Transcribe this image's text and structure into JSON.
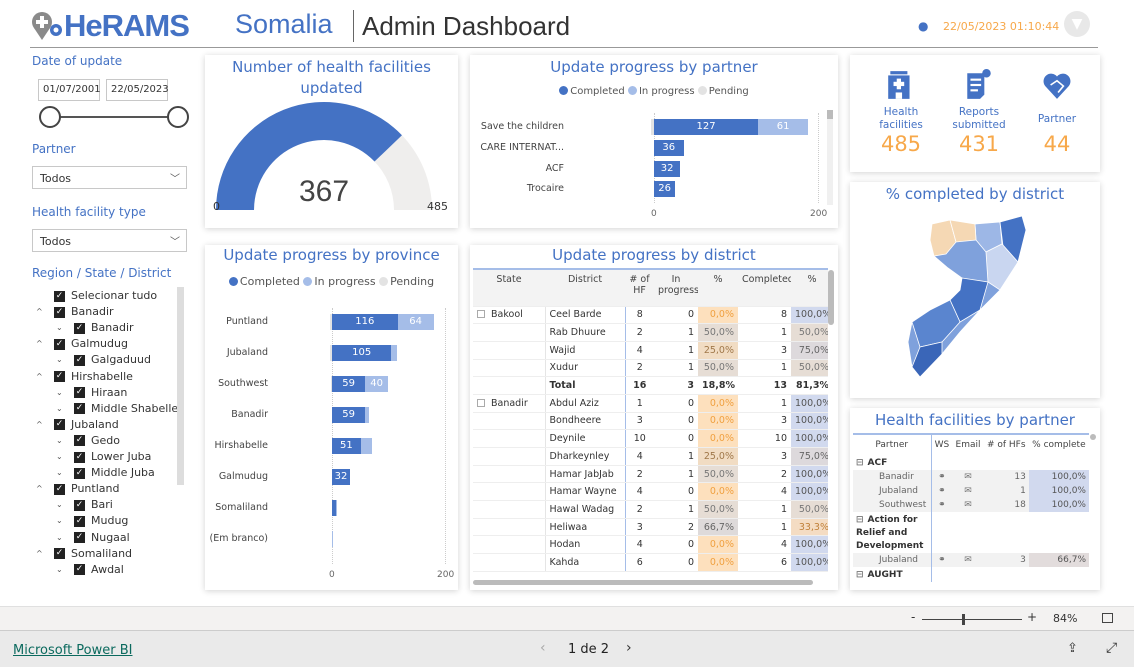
{
  "header": {
    "logo_text": "HeRAMS",
    "country": "Somalia",
    "title": "Admin Dashboard",
    "timestamp": "22/05/2023 01:10:44"
  },
  "filters": {
    "date_label": "Date of update",
    "date_from": "01/07/2001",
    "date_to": "22/05/2023",
    "partner_label": "Partner",
    "partner_value": "Todos",
    "hf_type_label": "Health facility type",
    "hf_type_value": "Todos",
    "region_label": "Region / State / District",
    "tree": [
      {
        "label": "Selecionar tudo",
        "level": 0,
        "expand": false
      },
      {
        "label": "Banadir",
        "level": 0,
        "expand": true
      },
      {
        "label": "Banadir",
        "level": 1,
        "expand": true
      },
      {
        "label": "Galmudug",
        "level": 0,
        "expand": true
      },
      {
        "label": "Galgaduud",
        "level": 1,
        "expand": true
      },
      {
        "label": "Hirshabelle",
        "level": 0,
        "expand": true
      },
      {
        "label": "Hiraan",
        "level": 1,
        "expand": true
      },
      {
        "label": "Middle Shabelle",
        "level": 1,
        "expand": true
      },
      {
        "label": "Jubaland",
        "level": 0,
        "expand": true
      },
      {
        "label": "Gedo",
        "level": 1,
        "expand": true
      },
      {
        "label": "Lower Juba",
        "level": 1,
        "expand": true
      },
      {
        "label": "Middle Juba",
        "level": 1,
        "expand": true
      },
      {
        "label": "Puntland",
        "level": 0,
        "expand": true
      },
      {
        "label": "Bari",
        "level": 1,
        "expand": true
      },
      {
        "label": "Mudug",
        "level": 1,
        "expand": true
      },
      {
        "label": "Nugaal",
        "level": 1,
        "expand": true
      },
      {
        "label": "Somaliland",
        "level": 0,
        "expand": true
      },
      {
        "label": "Awdal",
        "level": 1,
        "expand": true
      }
    ]
  },
  "gauge": {
    "title": "Number of health facilities updated",
    "value": 367,
    "min": 0,
    "max": 485,
    "value_text": "367",
    "min_text": "0",
    "max_text": "485",
    "color": "#4472c4"
  },
  "colors": {
    "completed": "#4472c4",
    "in_progress": "#a5bde8",
    "pending": "#e3e3e3",
    "kpi": "#f7a84a"
  },
  "legend": {
    "completed": "Completed",
    "in_progress": "In progress",
    "pending": "Pending"
  },
  "chart_data": [
    {
      "type": "bar",
      "title": "Update progress by partner",
      "orientation": "horizontal",
      "stacked": true,
      "categories": [
        "Save the children",
        "CARE INTERNAT...",
        "ACF",
        "Trocaire"
      ],
      "series": [
        {
          "name": "Completed",
          "values": [
            127,
            36,
            32,
            26
          ]
        },
        {
          "name": "In progress",
          "values": [
            61,
            0,
            0,
            0
          ]
        },
        {
          "name": "Pending",
          "values": [
            4,
            0,
            0,
            0
          ]
        }
      ],
      "xlim": [
        0,
        200
      ],
      "ticks": [
        "0",
        "200"
      ]
    },
    {
      "type": "bar",
      "title": "Update progress by province",
      "orientation": "horizontal",
      "stacked": true,
      "categories": [
        "Puntland",
        "Jubaland",
        "Southwest",
        "Banadir",
        "Hirshabelle",
        "Galmudug",
        "Somaliland",
        "(Em branco)"
      ],
      "series": [
        {
          "name": "Completed",
          "values": [
            116,
            105,
            59,
            59,
            51,
            32,
            7,
            0
          ]
        },
        {
          "name": "In progress",
          "values": [
            64,
            10,
            40,
            7,
            19,
            0,
            1,
            1
          ]
        },
        {
          "name": "Pending",
          "values": [
            4,
            3,
            2,
            0,
            0,
            0,
            0,
            0
          ]
        }
      ],
      "labels": [
        [
          "116",
          "64"
        ],
        [
          "105",
          ""
        ],
        [
          "59",
          "40"
        ],
        [
          "59",
          ""
        ],
        [
          "51",
          ""
        ],
        [
          "32",
          ""
        ],
        [
          "",
          ""
        ],
        [
          "",
          ""
        ]
      ],
      "xlim": [
        0,
        200
      ],
      "ticks": [
        "0",
        "200"
      ]
    }
  ],
  "kpis": [
    {
      "icon": "hospital-icon",
      "label": "Health facilities",
      "value": "485"
    },
    {
      "icon": "report-icon",
      "label": "Reports submitted",
      "value": "431"
    },
    {
      "icon": "handshake-heart-icon",
      "label": "Partner",
      "value": "44"
    }
  ],
  "map": {
    "title": "% completed by district"
  },
  "district_table": {
    "title": "Update progress by district",
    "headers": [
      "State",
      "District",
      "# of HF",
      "In progress",
      "%",
      "Completed",
      "%"
    ],
    "rows": [
      [
        "Bakool",
        "Ceel Barde",
        "8",
        "0",
        "0,0%",
        "8",
        "100,0%"
      ],
      [
        "",
        "Rab Dhuure",
        "2",
        "1",
        "50,0%",
        "1",
        "50,0%"
      ],
      [
        "",
        "Wajid",
        "4",
        "1",
        "25,0%",
        "3",
        "75,0%"
      ],
      [
        "",
        "Xudur",
        "2",
        "1",
        "50,0%",
        "1",
        "50,0%"
      ],
      [
        "",
        "Total",
        "16",
        "3",
        "18,8%",
        "13",
        "81,3%"
      ],
      [
        "Banadir",
        "Abdul Aziz",
        "1",
        "0",
        "0,0%",
        "1",
        "100,0%"
      ],
      [
        "",
        "Bondheere",
        "3",
        "0",
        "0,0%",
        "3",
        "100,0%"
      ],
      [
        "",
        "Deynile",
        "10",
        "0",
        "0,0%",
        "10",
        "100,0%"
      ],
      [
        "",
        "Dharkeynley",
        "4",
        "1",
        "25,0%",
        "3",
        "75,0%"
      ],
      [
        "",
        "Hamar JabJab",
        "2",
        "1",
        "50,0%",
        "2",
        "100,0%"
      ],
      [
        "",
        "Hamar Wayne",
        "4",
        "0",
        "0,0%",
        "4",
        "100,0%"
      ],
      [
        "",
        "Hawal Wadag",
        "2",
        "1",
        "50,0%",
        "1",
        "50,0%"
      ],
      [
        "",
        "Heliwaa",
        "3",
        "2",
        "66,7%",
        "1",
        "33,3%"
      ],
      [
        "",
        "Hodan",
        "4",
        "0",
        "0,0%",
        "4",
        "100,0%"
      ],
      [
        "",
        "Kahda",
        "6",
        "0",
        "0,0%",
        "6",
        "100,0%"
      ]
    ]
  },
  "partner_table": {
    "title": "Health facilities by partner",
    "headers": [
      "Partner",
      "WS",
      "Email",
      "# of HFs",
      "% complete"
    ],
    "rows": [
      {
        "type": "group",
        "label": "ACF"
      },
      {
        "type": "row",
        "label": "Banadir",
        "hfs": "13",
        "pct": "100,0%"
      },
      {
        "type": "row",
        "label": "Jubaland",
        "hfs": "1",
        "pct": "100,0%"
      },
      {
        "type": "row",
        "label": "Southwest",
        "hfs": "18",
        "pct": "100,0%"
      },
      {
        "type": "group",
        "label": "Action for Relief and Development"
      },
      {
        "type": "row",
        "label": "Jubaland",
        "hfs": "3",
        "pct": "66,7%"
      },
      {
        "type": "group",
        "label": "AUGHT"
      }
    ]
  },
  "footer": {
    "zoom": "84%",
    "brand": "Microsoft Power BI",
    "page": "1 de 2"
  }
}
